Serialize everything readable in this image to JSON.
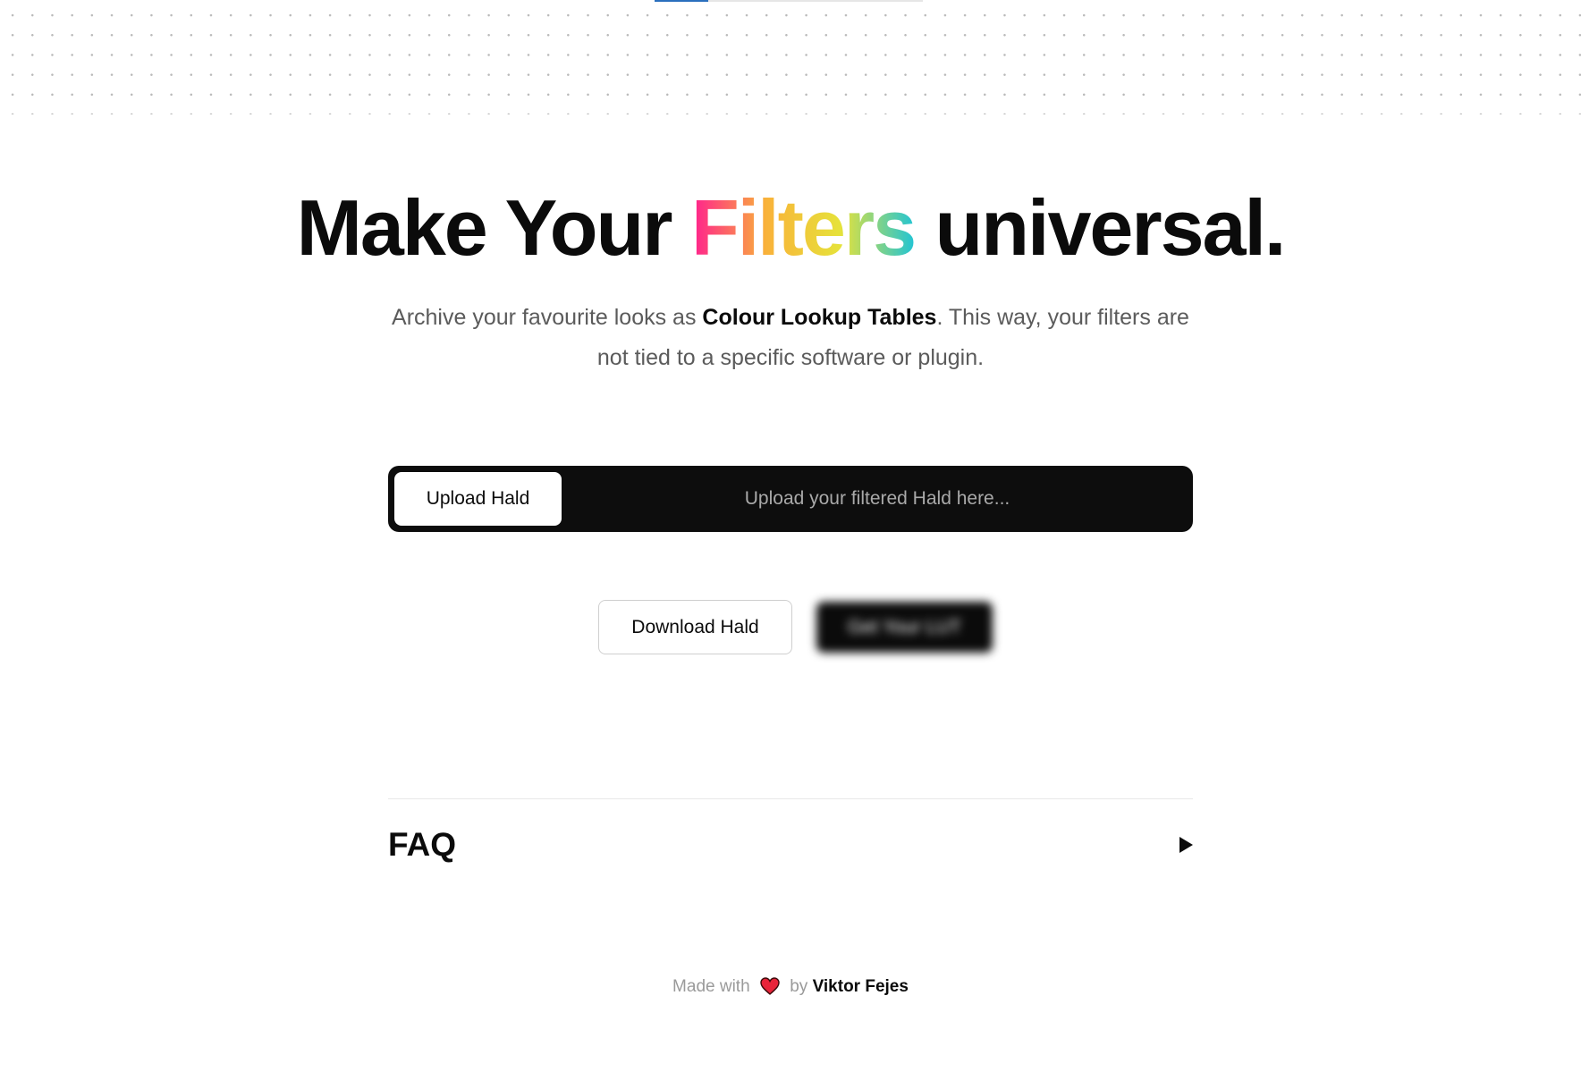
{
  "progress": {
    "fraction": 0.2,
    "track_color": "#e6e6e6",
    "fill_color": "#2a6fbd"
  },
  "hero": {
    "title_before": "Make Your ",
    "title_highlight": "Filters",
    "title_after": " universal.",
    "highlight_gradient": [
      "#ff1f8f",
      "#f9b23a",
      "#e6e23a",
      "#21c4d4"
    ],
    "subtitle_before": "Archive your favourite looks as ",
    "subtitle_bold": "Colour Lookup Tables",
    "subtitle_after": ". This way, your filters are not tied to a specific software or plugin."
  },
  "upload": {
    "button_label": "Upload Hald",
    "placeholder": "Upload your filtered Hald here..."
  },
  "actions": {
    "download_label": "Download Hald",
    "lut_label": "Get Your LUT"
  },
  "faq": {
    "title": "FAQ",
    "toggle_icon": "triangle-right-icon"
  },
  "footer": {
    "made_with": "Made with",
    "heart_icon": "heart-icon",
    "by": "by",
    "author": "Viktor Fejes",
    "heart_color": "#e8243a"
  }
}
